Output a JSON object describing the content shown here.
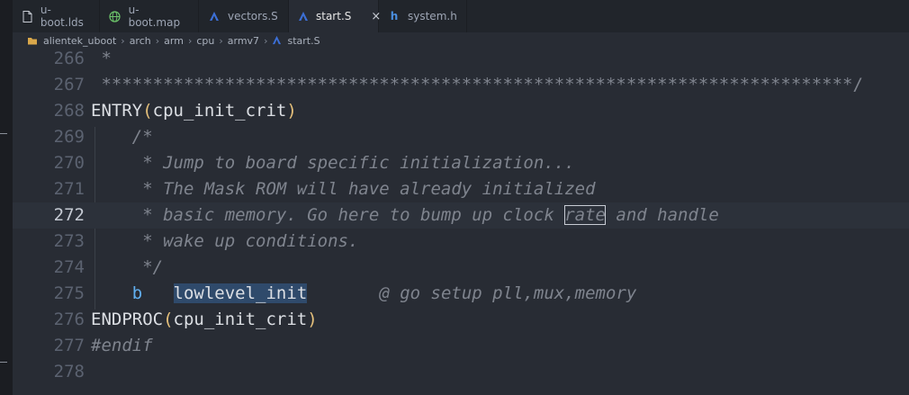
{
  "tabs": [
    {
      "label": "u-boot.lds",
      "icon": "file-icon",
      "active": false
    },
    {
      "label": "u-boot.map",
      "icon": "globe-icon",
      "active": false
    },
    {
      "label": "vectors.S",
      "icon": "asm-file-icon",
      "active": false
    },
    {
      "label": "start.S",
      "icon": "asm-file-icon",
      "active": true,
      "close": "×"
    },
    {
      "label": "system.h",
      "icon": "header-file-icon",
      "active": false
    }
  ],
  "breadcrumb": {
    "items": [
      "alientek_uboot",
      "arch",
      "arm",
      "cpu",
      "armv7",
      "start.S"
    ],
    "separator": "›"
  },
  "editor": {
    "current_line": "272",
    "lines": [
      {
        "num": "266",
        "text": " *"
      },
      {
        "num": "267",
        "text": " *************************************************************************/"
      },
      {
        "num": "268",
        "pre": "ENTRY",
        "paren_open": "(",
        "arg": "cpu_init_crit",
        "paren_close": ")"
      },
      {
        "num": "269",
        "text": "    /*"
      },
      {
        "num": "270",
        "text": "     * Jump to board specific initialization..."
      },
      {
        "num": "271",
        "text": "     * The Mask ROM will have already initialized"
      },
      {
        "num": "272",
        "pre": "     * basic memory. Go here to bump up clock ",
        "boxed": "rate",
        "post": " and handle"
      },
      {
        "num": "273",
        "text": "     * wake up conditions."
      },
      {
        "num": "274",
        "text": "     */"
      },
      {
        "num": "275",
        "indent": "    ",
        "kw": "b",
        "gap": "   ",
        "sym": "lowlevel_init",
        "gap2": "       ",
        "comment": "@ go setup pll,mux,memory"
      },
      {
        "num": "276",
        "pre": "ENDPROC",
        "paren_open": "(",
        "arg": "cpu_init_crit",
        "paren_close": ")"
      },
      {
        "num": "277",
        "text": "#endif"
      },
      {
        "num": "278",
        "text": ""
      }
    ]
  },
  "colors": {
    "background": "#282c34",
    "tabbar": "#21252b",
    "comment": "#7f848e",
    "paren": "#e5c07b",
    "keyword": "#61afef",
    "selection": "#2f4a6b"
  }
}
